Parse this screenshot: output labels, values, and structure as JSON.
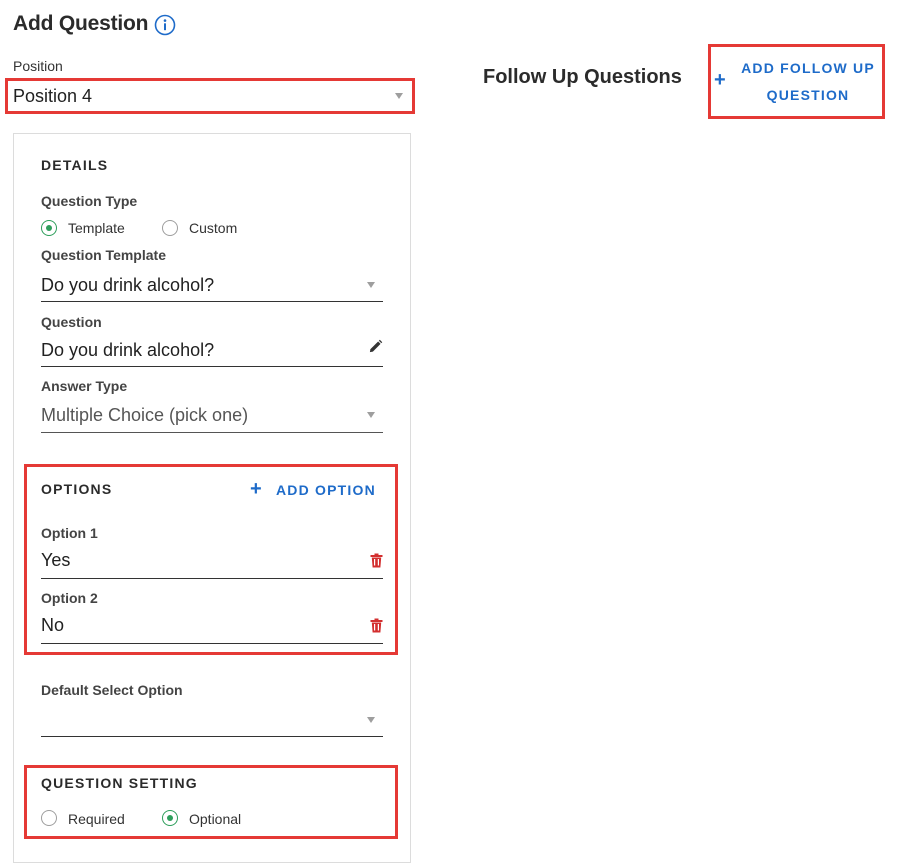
{
  "header": {
    "title": "Add Question",
    "info_icon": "info-circle-icon"
  },
  "position": {
    "label": "Position",
    "value": "Position 4"
  },
  "details": {
    "heading": "DETAILS",
    "question_type": {
      "label": "Question Type",
      "options": [
        "Template",
        "Custom"
      ],
      "selected": "Template"
    },
    "question_template": {
      "label": "Question Template",
      "value": "Do you drink alcohol?"
    },
    "question": {
      "label": "Question",
      "value": "Do you drink alcohol?",
      "icon": "pencil-icon"
    },
    "answer_type": {
      "label": "Answer Type",
      "value": "Multiple Choice (pick one)"
    }
  },
  "options": {
    "heading": "OPTIONS",
    "add_label": "ADD OPTION",
    "items": [
      {
        "label": "Option 1",
        "value": "Yes"
      },
      {
        "label": "Option 2",
        "value": "No"
      }
    ],
    "delete_icon": "trash-icon"
  },
  "default_select": {
    "label": "Default Select Option",
    "value": ""
  },
  "question_setting": {
    "heading": "QUESTION SETTING",
    "options": [
      "Required",
      "Optional"
    ],
    "selected": "Optional"
  },
  "follow_up": {
    "title": "Follow Up Questions",
    "add_label_line1": "ADD FOLLOW UP",
    "add_label_line2": "QUESTION"
  },
  "colors": {
    "accent_blue": "#1e6bc9",
    "radio_green": "#2e9e5b",
    "highlight_red": "#e53935",
    "delete_red": "#d32f2f"
  }
}
